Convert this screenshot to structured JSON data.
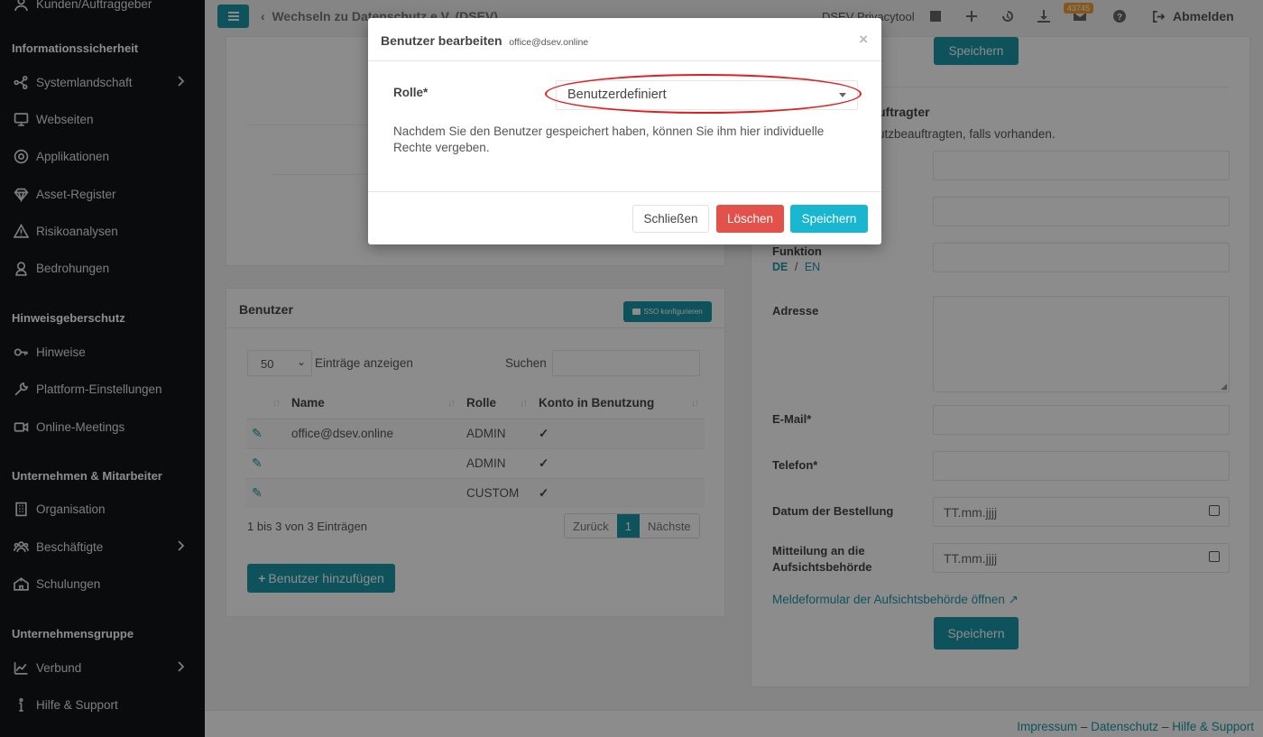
{
  "sidebar": {
    "top_item": "Kunden/Auftraggeber",
    "sections": [
      {
        "title": "Informationssicherheit"
      },
      {
        "title": "Hinweisgeberschutz"
      },
      {
        "title": "Unternehmen & Mitarbeiter"
      },
      {
        "title": "Unternehmensgruppe"
      }
    ],
    "items": [
      {
        "label": "Systemlandschaft",
        "icon": "network-icon",
        "submenu": true
      },
      {
        "label": "Webseiten",
        "icon": "monitor-icon"
      },
      {
        "label": "Applikationen",
        "icon": "app-icon"
      },
      {
        "label": "Asset-Register",
        "icon": "diamond-icon"
      },
      {
        "label": "Risikoanalysen",
        "icon": "warning-icon"
      },
      {
        "label": "Bedrohungen",
        "icon": "hacker-icon"
      },
      {
        "label": "Hinweise",
        "icon": "key-icon"
      },
      {
        "label": "Plattform-Einstellungen",
        "icon": "wrench-icon"
      },
      {
        "label": "Online-Meetings",
        "icon": "video-icon"
      },
      {
        "label": "Organisation",
        "icon": "building-icon"
      },
      {
        "label": "Beschäftigte",
        "icon": "people-icon",
        "submenu": true
      },
      {
        "label": "Schulungen",
        "icon": "school-icon"
      },
      {
        "label": "Verbund",
        "icon": "factory-icon",
        "submenu": true
      },
      {
        "label": "Hilfe & Support",
        "icon": "info-icon"
      }
    ]
  },
  "topbar": {
    "back_label": "Wechseln zu Datenschutz e.V. (DSEV)",
    "app_title": "DSEV Privacytool",
    "mail_badge": "43745",
    "logout_label": "Abmelden"
  },
  "left_panel": {
    "save_label": "Speichern"
  },
  "users_panel": {
    "title": "Benutzer",
    "sso_label": "SSO konfigurieren",
    "page_size": "50",
    "entries_label": "Einträge anzeigen",
    "search_label": "Suchen",
    "columns": [
      "Name",
      "Rolle",
      "Konto in Benutzung"
    ],
    "rows": [
      {
        "name": "office@dsev.online",
        "role": "ADMIN"
      },
      {
        "name": "",
        "role": "ADMIN"
      },
      {
        "name": "",
        "role": "CUSTOM"
      }
    ],
    "info": "1 bis 3 von 3 Einträgen",
    "prev_label": "Zurück",
    "page_label": "1",
    "next_label": "Nächste",
    "add_label": "Benutzer hinzufügen"
  },
  "right_panel": {
    "top_save_label": "Speichern",
    "section_title_partial": "uftragter",
    "section_desc_partial": "utzbeauftragten, falls vorhanden.",
    "funktion_label": "Funktion",
    "lang_de": "DE",
    "lang_sep": "/",
    "lang_en": "EN",
    "adresse_label": "Adresse",
    "email_label": "E-Mail*",
    "telefon_label": "Telefon*",
    "datum_label": "Datum der Bestellung",
    "datum_placeholder": "TT.mm.jjjj",
    "mitteilung_label_1": "Mitteilung an die",
    "mitteilung_label_2": "Aufsichtsbehörde",
    "mitteilung_placeholder": "TT.mm.jjjj",
    "meldeformular_link": "Meldeformular der Aufsichtsbehörde öffnen",
    "save_label": "Speichern"
  },
  "footer": {
    "impressum": "Impressum",
    "dash": "–",
    "datenschutz": "Datenschutz",
    "hilfe": "Hilfe & Support"
  },
  "modal": {
    "title": "Benutzer bearbeiten",
    "subtitle": "office@dsev.online",
    "role_label": "Rolle*",
    "role_value": "Benutzerdefiniert",
    "description": "Nachdem Sie den Benutzer gespeichert haben, können Sie ihm hier individuelle Rechte vergeben.",
    "close_label": "Schließen",
    "delete_label": "Löschen",
    "save_label": "Speichern",
    "highlight_color": "#e02020"
  },
  "colors": {
    "teal": "#1a98a6",
    "cyan": "#19b6d0",
    "red": "#e2524b",
    "sidebar_bg": "#111418"
  }
}
